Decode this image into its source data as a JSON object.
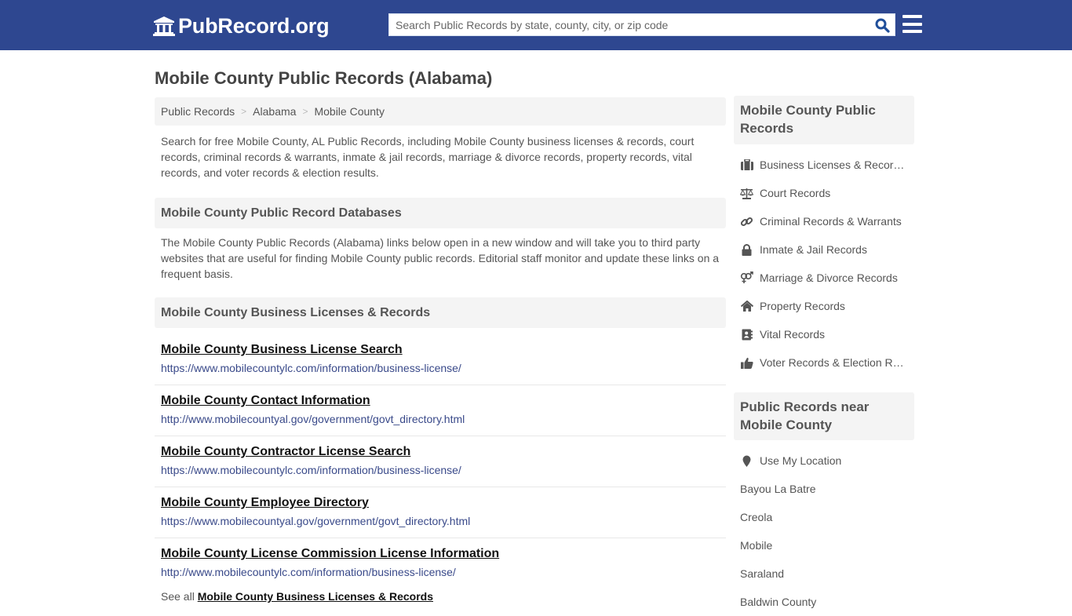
{
  "header": {
    "logo_text": "PubRecord.org",
    "search_placeholder": "Search Public Records by state, county, city, or zip code",
    "brand_color": "#2e4790"
  },
  "page": {
    "title": "Mobile County Public Records (Alabama)",
    "breadcrumb": [
      "Public Records",
      "Alabama",
      "Mobile County"
    ],
    "breadcrumb_separator": ">",
    "intro": "Search for free Mobile County, AL Public Records, including Mobile County business licenses & records, court records, criminal records & warrants, inmate & jail records, marriage & divorce records, property records, vital records, and voter records & election results."
  },
  "databases": {
    "heading": "Mobile County Public Record Databases",
    "text": "The Mobile County Public Records (Alabama) links below open in a new window and will take you to third party websites that are useful for finding Mobile County public records. Editorial staff monitor and update these links on a frequent basis."
  },
  "business": {
    "heading": "Mobile County Business Licenses & Records",
    "links": [
      {
        "title": "Mobile County Business License Search",
        "url": "https://www.mobilecountylc.com/information/business-license/"
      },
      {
        "title": "Mobile County Contact Information",
        "url": "http://www.mobilecountyal.gov/government/govt_directory.html"
      },
      {
        "title": "Mobile County Contractor License Search",
        "url": "https://www.mobilecountylc.com/information/business-license/"
      },
      {
        "title": "Mobile County Employee Directory",
        "url": "https://www.mobilecountyal.gov/government/govt_directory.html"
      },
      {
        "title": "Mobile County License Commission License Information",
        "url": "http://www.mobilecountylc.com/information/business-license/"
      }
    ],
    "see_all_prefix": "See all",
    "see_all_link": "Mobile County Business Licenses & Records"
  },
  "sidebar": {
    "records_heading": "Mobile County Public Records",
    "records": [
      {
        "label": "Business Licenses & Records",
        "icon": "briefcase-icon"
      },
      {
        "label": "Court Records",
        "icon": "balance-scale-icon"
      },
      {
        "label": "Criminal Records & Warrants",
        "icon": "link-icon"
      },
      {
        "label": "Inmate & Jail Records",
        "icon": "lock-icon"
      },
      {
        "label": "Marriage & Divorce Records",
        "icon": "venus-mars-icon"
      },
      {
        "label": "Property Records",
        "icon": "home-icon"
      },
      {
        "label": "Vital Records",
        "icon": "address-book-icon"
      },
      {
        "label": "Voter Records & Election Results",
        "icon": "thumbs-up-icon"
      }
    ],
    "near_heading": "Public Records near Mobile County",
    "use_location": "Use My Location",
    "nearby": [
      "Bayou La Batre",
      "Creola",
      "Mobile",
      "Saraland",
      "Baldwin County"
    ]
  }
}
